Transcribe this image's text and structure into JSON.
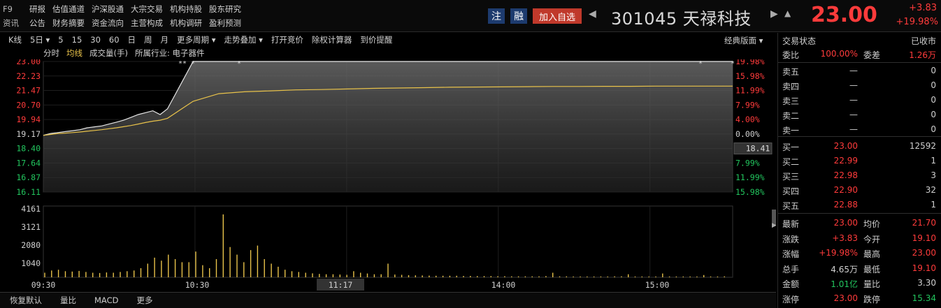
{
  "nav": {
    "row1": [
      "F9",
      "研报",
      "估值通道",
      "沪深股通",
      "大宗交易",
      "机构持股",
      "股东研究"
    ],
    "row2": [
      "资讯",
      "公告",
      "财务摘要",
      "资金流向",
      "主营构成",
      "机构调研",
      "盈利预测"
    ]
  },
  "header": {
    "badge_zhu": "注",
    "badge_rong": "融",
    "add_fav": "加入自选",
    "prev": "◀",
    "next": "▶",
    "bell": "🔔",
    "title": "301045 天禄科技",
    "price": "23.00",
    "chg_abs": "+3.83",
    "chg_pct": "+19.98%"
  },
  "toolbar": {
    "items": [
      "K线",
      "5日 ▾",
      "5",
      "15",
      "30",
      "60",
      "日",
      "周",
      "月",
      "更多周期 ▾",
      "走势叠加 ▾",
      "打开竞价",
      "除权计算器",
      "到价提醒"
    ],
    "layout": "经典版面 ▾"
  },
  "subtool": {
    "minute": "分时",
    "avg": "均线",
    "volume": "成交量(手)",
    "industry": "所属行业: 电子器件"
  },
  "chart_data": {
    "type": "line",
    "price_ticks": [
      "23.00",
      "22.23",
      "21.47",
      "20.70",
      "19.94",
      "19.17",
      "18.40",
      "17.64",
      "16.87",
      "16.11"
    ],
    "pct_ticks": [
      "19.98%",
      "15.98%",
      "11.99%",
      "7.99%",
      "4.00%",
      "0.00%",
      "4.00%",
      "7.99%",
      "11.99%",
      "15.98%"
    ],
    "prev_close": "18.41",
    "ylim": [
      16.11,
      23.0
    ],
    "vol_ticks": [
      "4161",
      "3121",
      "2080",
      "1040"
    ],
    "time_ticks": [
      "09:30",
      "10:30",
      "11:17",
      "14:00",
      "15:00"
    ],
    "price_series": [
      19.1,
      19.2,
      19.25,
      19.3,
      19.35,
      19.4,
      19.5,
      19.55,
      19.6,
      19.7,
      19.8,
      19.9,
      20.05,
      20.2,
      20.3,
      20.4,
      20.2,
      20.5,
      23.0,
      23.0,
      23.0,
      23.0,
      23.0,
      23.0,
      23.0,
      23.0,
      23.0,
      23.0,
      23.0,
      23.0,
      23.0,
      23.0,
      23.0,
      23.0,
      23.0,
      23.0,
      23.0,
      23.0,
      23.0,
      23.0
    ],
    "avg_series": [
      19.1,
      19.15,
      19.2,
      19.22,
      19.25,
      19.28,
      19.32,
      19.36,
      19.4,
      19.45,
      19.5,
      19.56,
      19.62,
      19.7,
      19.78,
      19.85,
      19.9,
      20.0,
      20.9,
      21.3,
      21.4,
      21.45,
      21.5,
      21.52,
      21.55,
      21.58,
      21.6,
      21.62,
      21.64,
      21.65,
      21.66,
      21.67,
      21.68,
      21.68,
      21.69,
      21.69,
      21.7,
      21.7,
      21.7,
      21.7
    ],
    "volumes": [
      300,
      450,
      500,
      400,
      380,
      420,
      350,
      300,
      280,
      320,
      300,
      350,
      400,
      450,
      600,
      900,
      1300,
      1100,
      1500,
      1200,
      1000,
      1000,
      1700,
      800,
      600,
      1200,
      4161,
      2000,
      1500,
      1000,
      1800,
      2100,
      1200,
      900,
      700,
      500,
      400,
      350,
      300,
      260,
      220,
      200,
      200,
      180,
      160,
      400,
      300,
      250,
      200,
      200,
      900,
      180,
      160,
      140,
      130,
      120,
      110,
      100,
      100,
      100,
      100,
      90,
      90,
      80,
      80,
      80,
      70,
      70,
      60,
      60,
      60,
      60,
      60,
      80,
      300,
      60,
      60,
      50,
      50,
      50,
      50,
      50,
      50,
      60,
      60,
      200,
      50,
      50,
      50,
      50,
      250,
      50,
      50,
      50,
      50,
      50,
      150,
      50,
      50,
      60
    ]
  },
  "orderbook": {
    "status_label": "交易状态",
    "status_value": "已收市",
    "weibi_label": "委比",
    "weibi_value": "100.00%",
    "weicha_label": "委差",
    "weicha_value": "1.26万",
    "asks": [
      {
        "label": "卖五",
        "price": "—",
        "vol": "0"
      },
      {
        "label": "卖四",
        "price": "—",
        "vol": "0"
      },
      {
        "label": "卖三",
        "price": "—",
        "vol": "0"
      },
      {
        "label": "卖二",
        "price": "—",
        "vol": "0"
      },
      {
        "label": "卖一",
        "price": "—",
        "vol": "0"
      }
    ],
    "bids": [
      {
        "label": "买一",
        "price": "23.00",
        "vol": "12592"
      },
      {
        "label": "买二",
        "price": "22.99",
        "vol": "1"
      },
      {
        "label": "买三",
        "price": "22.98",
        "vol": "3"
      },
      {
        "label": "买四",
        "price": "22.90",
        "vol": "32"
      },
      {
        "label": "买五",
        "price": "22.88",
        "vol": "1"
      }
    ]
  },
  "stats": [
    {
      "l1": "最新",
      "v1": "23.00",
      "c1": "red",
      "l2": "均价",
      "v2": "21.70",
      "c2": "red"
    },
    {
      "l1": "涨跌",
      "v1": "+3.83",
      "c1": "red",
      "l2": "今开",
      "v2": "19.10",
      "c2": "red"
    },
    {
      "l1": "涨幅",
      "v1": "+19.98%",
      "c1": "red",
      "l2": "最高",
      "v2": "23.00",
      "c2": "red"
    },
    {
      "l1": "总手",
      "v1": "4.65万",
      "c1": "grey",
      "l2": "最低",
      "v2": "19.10",
      "c2": "red"
    },
    {
      "l1": "金额",
      "v1": "1.01亿",
      "c1": "green",
      "l2": "量比",
      "v2": "3.30",
      "c2": "grey"
    },
    {
      "l1": "涨停",
      "v1": "23.00",
      "c1": "red",
      "l2": "跌停",
      "v2": "15.34",
      "c2": "green"
    }
  ],
  "bottom_tabs": [
    "恢复默认",
    "量比",
    "MACD",
    "更多"
  ]
}
